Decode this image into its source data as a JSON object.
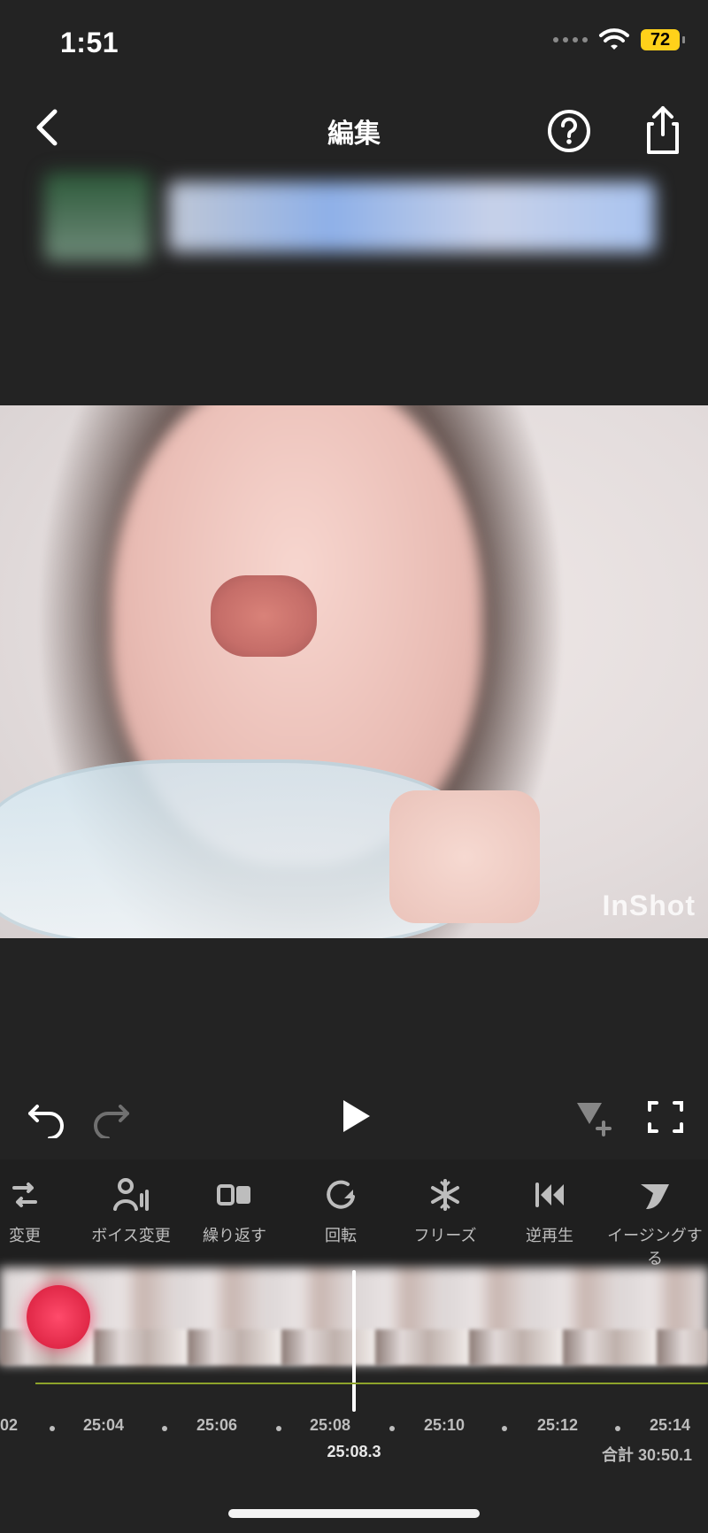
{
  "status_bar": {
    "time": "1:51",
    "battery": "72"
  },
  "header": {
    "title": "編集"
  },
  "tools": [
    {
      "label": "変更",
      "icon": "replace-icon"
    },
    {
      "label": "ボイス変更",
      "icon": "voice-change-icon"
    },
    {
      "label": "繰り返す",
      "icon": "repeat-icon"
    },
    {
      "label": "回転",
      "icon": "rotate-icon"
    },
    {
      "label": "フリーズ",
      "icon": "freeze-icon"
    },
    {
      "label": "逆再生",
      "icon": "reverse-icon"
    },
    {
      "label": "イージングする",
      "icon": "easing-icon"
    }
  ],
  "timeline": {
    "ruler": [
      "02",
      "25:04",
      "25:06",
      "25:08",
      "25:10",
      "25:12",
      "25:14"
    ],
    "current_time": "25:08.3",
    "total": "合計 30:50.1"
  },
  "video": {
    "watermark": "InShot"
  }
}
